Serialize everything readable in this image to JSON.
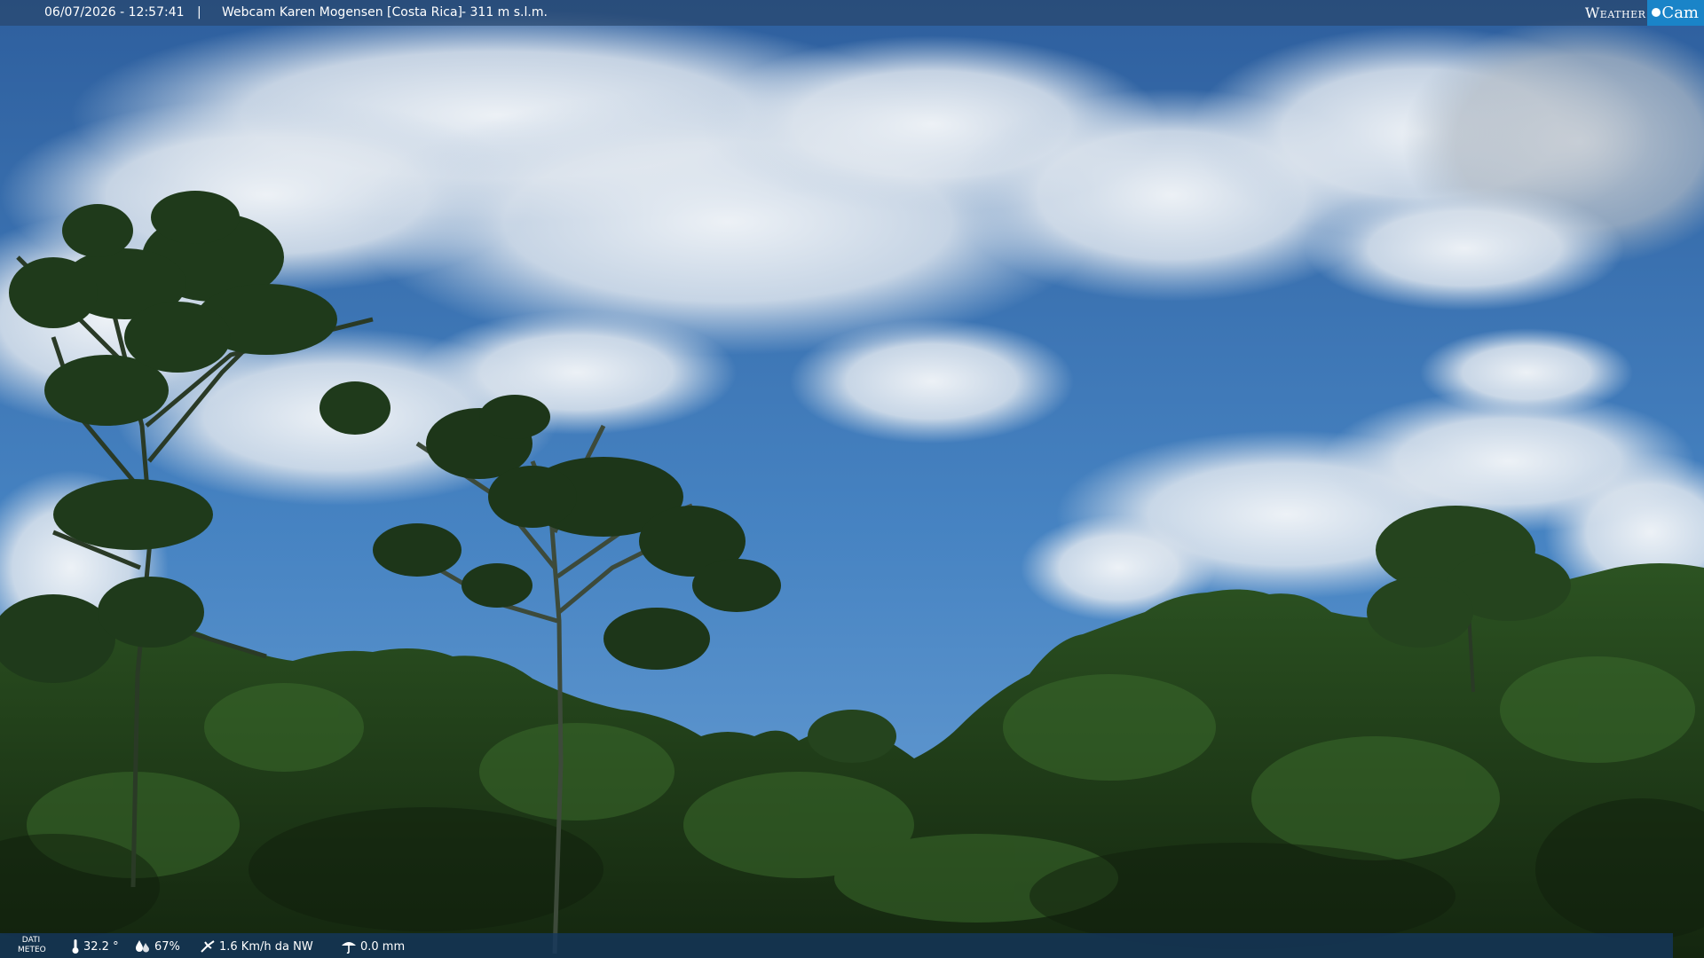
{
  "overlay": {
    "datetime": "06/07/2026 - 12:57:41",
    "separator": "|",
    "location": "Webcam Karen Mogensen [Costa Rica]",
    "altitude": "- 311 m s.l.m."
  },
  "logo": {
    "word1": "Weather",
    "word2": "Cam",
    "accent_color": "#1a84c8"
  },
  "weather_bar": {
    "label_line1": "DATI",
    "label_line2": "METEO",
    "temperature": "32.2 °",
    "humidity": "67%",
    "wind": "1.6 Km/h da NW",
    "rain": "0.0 mm",
    "icons": [
      "thermometer-icon",
      "humidity-icon",
      "wind-icon",
      "rain-icon"
    ]
  },
  "colors": {
    "sky_top": "#2e63a3",
    "sky_mid": "#4a86c4",
    "cloud": "#e9eef3",
    "forest_dark": "#1b3318",
    "forest_mid": "#2f5a22"
  }
}
